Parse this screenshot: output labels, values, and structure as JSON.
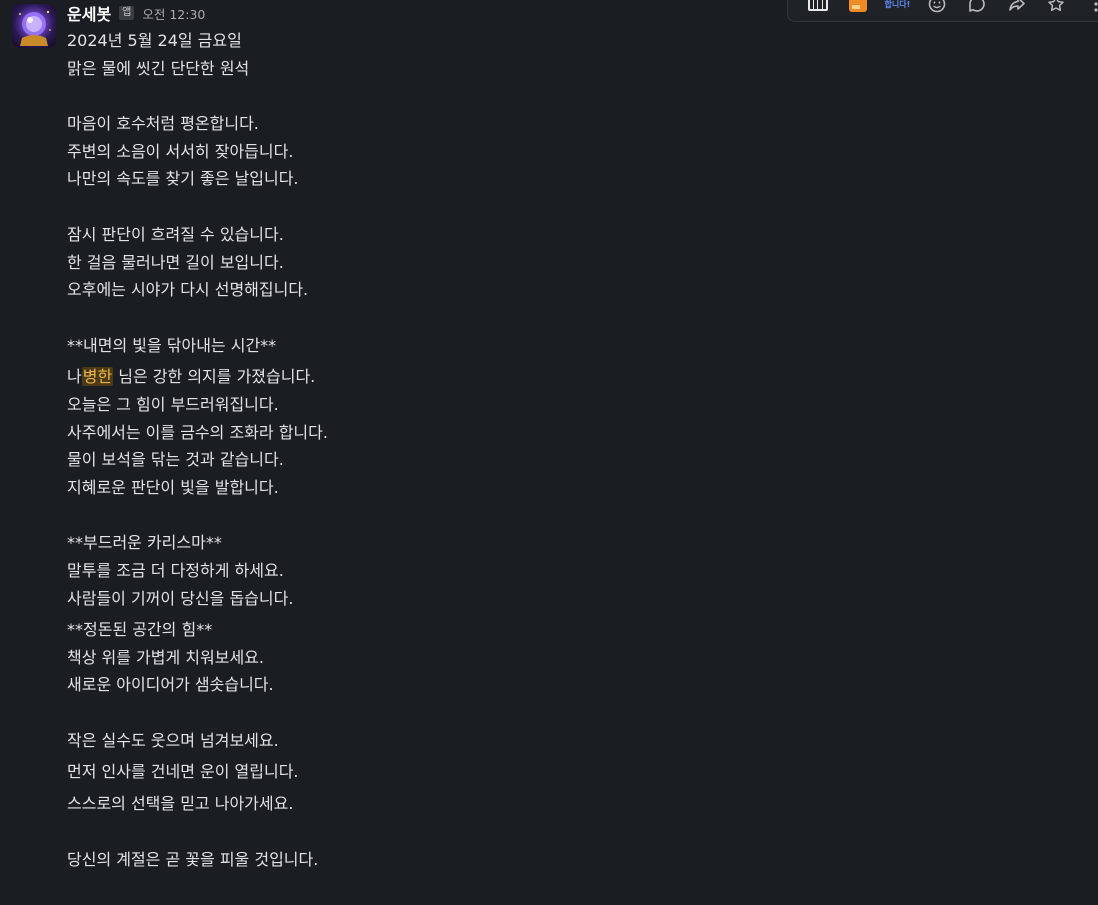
{
  "message": {
    "sender": "운세봇",
    "app_badge": "앱",
    "timestamp": "오전 12:30",
    "lines": {
      "l01": "2024년 5월 24일 금요일",
      "l02": "맑은 물에 씻긴 단단한 원석",
      "l03": "마음이 호수처럼 평온합니다.",
      "l04": "주변의 소음이 서서히 잦아듭니다.",
      "l05": "나만의 속도를 찾기 좋은 날입니다.",
      "l06": "잠시 판단이 흐려질 수 있습니다.",
      "l07": "한 걸음 물러나면 길이 보입니다.",
      "l08": "오후에는 시야가 다시 선명해집니다.",
      "l09": "**내면의 빛을 닦아내는 시간**",
      "l10_pre": "나",
      "l10_mention": "병한",
      "l10_post": " 님은 강한 의지를 가졌습니다.",
      "l11": "오늘은 그 힘이 부드러워집니다.",
      "l12": "사주에서는 이를 금수의 조화라 합니다.",
      "l13": "물이 보석을 닦는 것과 같습니다.",
      "l14": "지혜로운 판단이 빛을 발합니다.",
      "l15": "**부드러운 카리스마**",
      "l16": "말투를 조금 더 다정하게 하세요.",
      "l17": "사람들이 기꺼이 당신을 돕습니다.",
      "l18": "**정돈된 공간의 힘**",
      "l19": "책상 위를 가볍게 치워보세요.",
      "l20": "새로운 아이디어가 샘솟습니다.",
      "l21": "작은 실수도 웃으며 넘겨보세요.",
      "l22": "먼저 인사를 건네면 운이 열립니다.",
      "l23": "스스로의 선택을 믿고 나아가세요.",
      "l24": "당신의 계절은 곧 꽃을 피울 것입니다."
    }
  },
  "toolbar": {
    "icons": [
      "keyboard-emoji-icon",
      "orange-emoji-icon",
      "text-emoji-icon",
      "add-reaction-icon",
      "reply-thread-icon",
      "share-icon",
      "bookmark-icon",
      "more-actions-icon"
    ],
    "text_emoji_label": "합니다!"
  },
  "colors": {
    "background": "#1a1d21",
    "text": "#e2e3e4",
    "mention_text": "#f0b64a",
    "mention_bg": "#4a3a16"
  }
}
